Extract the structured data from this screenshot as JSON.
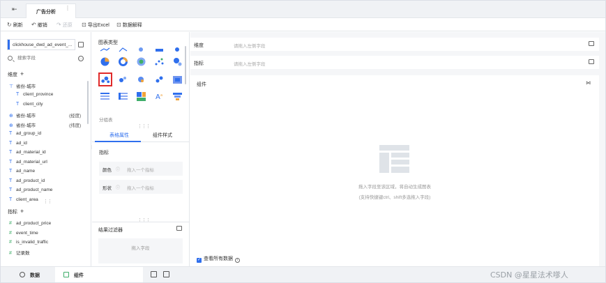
{
  "app": {
    "tab_title": "广告分析",
    "more_glyph": "⋮"
  },
  "toolbar": {
    "refresh_label": "刷新",
    "undo_label": "撤销",
    "redo_label": "还原",
    "export_label": "导出Excel",
    "explain_label": "数据解释"
  },
  "left": {
    "dataset_name": "clickhouse_dwd_ad_event_...",
    "search_placeholder": "搜索字段",
    "dimension_title": "维度",
    "metric_title": "指标",
    "dimensions": [
      {
        "label": "省份-城市",
        "type": "hierarchy"
      },
      {
        "label": "client_province",
        "type": "text"
      },
      {
        "label": "client_city",
        "type": "text"
      },
      {
        "label": "省份-城市",
        "type": "geo",
        "extra": "(经度)"
      },
      {
        "label": "省份-城市",
        "type": "geo",
        "extra": "(纬度)"
      },
      {
        "label": "ad_group_id",
        "type": "text"
      },
      {
        "label": "ad_id",
        "type": "text"
      },
      {
        "label": "ad_material_id",
        "type": "text"
      },
      {
        "label": "ad_material_url",
        "type": "text"
      },
      {
        "label": "ad_name",
        "type": "text"
      },
      {
        "label": "ad_product_id",
        "type": "text"
      },
      {
        "label": "ad_product_name",
        "type": "text"
      },
      {
        "label": "client_area",
        "type": "text"
      }
    ],
    "metrics": [
      {
        "label": "ad_product_price",
        "type": "number"
      },
      {
        "label": "event_time",
        "type": "number"
      },
      {
        "label": "is_invalid_traffic",
        "type": "number"
      },
      {
        "label": "记录数",
        "type": "number"
      }
    ]
  },
  "middle": {
    "chart_type_title": "图表类型",
    "subcategory_label": "分组表",
    "tabs": [
      "表格属性",
      "组件样式"
    ],
    "active_tab": 0,
    "metric_label": "指标",
    "properties": [
      {
        "name": "颜色",
        "placeholder": "拖入一个指标"
      },
      {
        "name": "形状",
        "placeholder": "拖入一个指标"
      }
    ],
    "filter_title": "结果过滤器",
    "filter_placeholder": "拖入字段",
    "selected_chart": "scatter-icon",
    "accent_color": "#2f6fed",
    "selection_color": "#e02a2a"
  },
  "right": {
    "dimension_shelf_label": "维度",
    "dimension_shelf_placeholder": "请拖入左侧字段",
    "metric_shelf_label": "指标",
    "metric_shelf_placeholder": "请拖入左侧字段",
    "widget_label": "组件",
    "empty_hint_1": "拖入字段至该区域，将自动生成图表",
    "empty_hint_2": "(支持快捷键ctrl、shift多选拖入字段)",
    "view_all_label": "查看所有数据"
  },
  "bottom": {
    "data_tab": "数据",
    "component_tab": "组件"
  },
  "watermark": "CSDN @星星法术嗲人"
}
